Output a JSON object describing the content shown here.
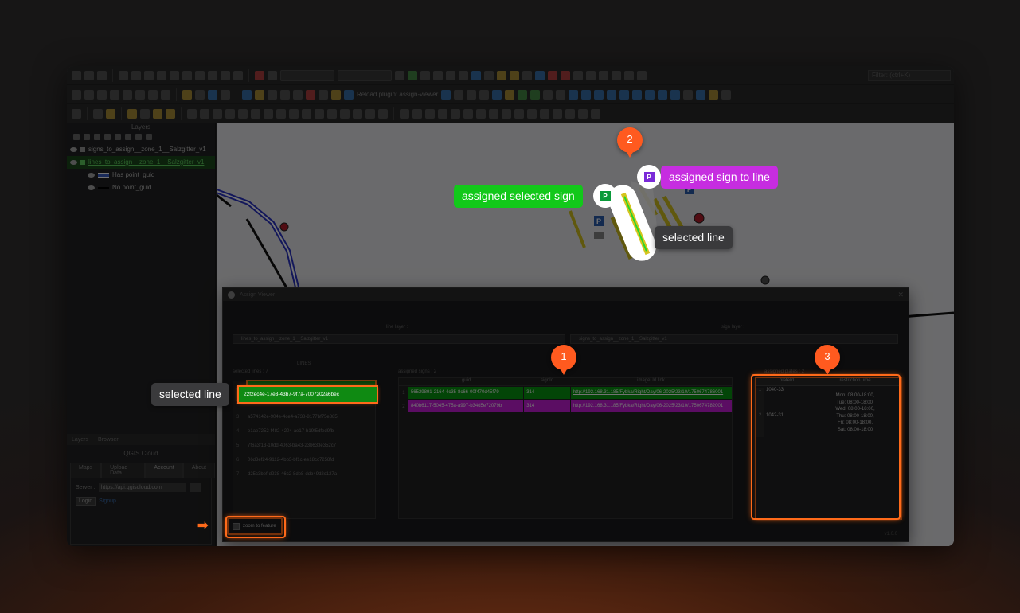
{
  "toolbar": {
    "reload_label": "Reload plugin: assign-viewer",
    "search_placeholder": "Filter: (ctrl+K)"
  },
  "layers_panel": {
    "title": "Layers",
    "items": [
      {
        "label": "signs_to_assign__zone_1__Salzgitter_v1"
      },
      {
        "label": "lines_to_assign__zone_1__Salzgitter_v1"
      },
      {
        "label": "Has point_guid"
      },
      {
        "label": "No point_guid"
      }
    ],
    "tabs": [
      "Layers",
      "Browser"
    ]
  },
  "qgis_cloud": {
    "title": "QGIS Cloud",
    "tabs": [
      "Maps",
      "Upload Data",
      "Account",
      "About"
    ],
    "server_label": "Server :",
    "server_value": "https://api.qgiscloud.com",
    "login_label": "Login",
    "signup_label": "Signup"
  },
  "dialog": {
    "title": "Assign Viewer",
    "line_layer_label": "line layer :",
    "line_layer_value": "lines_to_assign__zone_1__Salzgitter_v1",
    "sign_layer_label": "sign layer :",
    "sign_layer_value": "signs_to_assign__zone_1__Salzgitter_v1",
    "lines_title": "LINES",
    "selected_lines_label": "selected lines : 7",
    "assigned_signs_label": "assigned signs : 2",
    "plates_label": "assigned plates : 2",
    "lines": [
      {
        "n": "1",
        "id": "22f2ec4e-17e3-43b7-9f7a-7007202a6bec"
      },
      {
        "n": "2",
        "id": "189f54e1-1dbc-4b2b-8bed-4f3fed74db3c"
      },
      {
        "n": "3",
        "id": "a574142e-904e-4ce4-a738-8177bf75e885"
      },
      {
        "n": "4",
        "id": "e1ae7252-f482-4204-ae17-b19f5dfed9fb"
      },
      {
        "n": "5",
        "id": "7f6a3f13-10dd-4063-ba43-23b633e352c7"
      },
      {
        "n": "6",
        "id": "06d3ef24-9112-4bb3-bf1c-ee18cc7258fd"
      },
      {
        "n": "7",
        "id": "d25c3bef-d238-46c2-8de8-ddb49d2c127a"
      }
    ],
    "sign_columns": [
      "guid",
      "signId",
      "imageUrl.link"
    ],
    "signs": [
      {
        "n": "1",
        "guid": "56529891-2164-4c35-8c66-00f470d45f79",
        "signId": "314",
        "url": "http://192.168.31.185/Fybka/Right/Day/06-2025/23/10/1750674786001"
      },
      {
        "n": "2",
        "guid": "840b6117-5045-475a-a997-b34d5e72079b",
        "signId": "314",
        "url": "http://192.168.31.185/Fybka/Right/Day/06-2025/23/10/1750674782001"
      }
    ],
    "plate_columns": [
      "plateId",
      "restrictionTime"
    ],
    "plates": [
      {
        "n": "1",
        "id": "1040-33",
        "time": [
          "",
          "",
          "Mon: 08:00-18:00,",
          "Tue: 08:00-18:00,",
          "Wed: 08:00-18:00,",
          "Thu: 08:00-18:00,",
          "Fri: 08:00-18:00,",
          "Sat: 08:00-18:00"
        ]
      },
      {
        "n": "2",
        "id": "1042-31",
        "time": []
      }
    ],
    "zoom_label": "zoom to feature",
    "version": "v1.0.0"
  },
  "callouts": {
    "assigned_sign_to_line": "assigned sign to line",
    "assigned_selected_sign": "assigned selected sign",
    "selected_line_map": "selected line",
    "selected_line_list": "selected line"
  },
  "badges": {
    "one": "1",
    "two": "2",
    "three": "3"
  },
  "colors": {
    "accent": "#ff5a1f",
    "green": "#12c81a",
    "purple": "#c62de0"
  }
}
